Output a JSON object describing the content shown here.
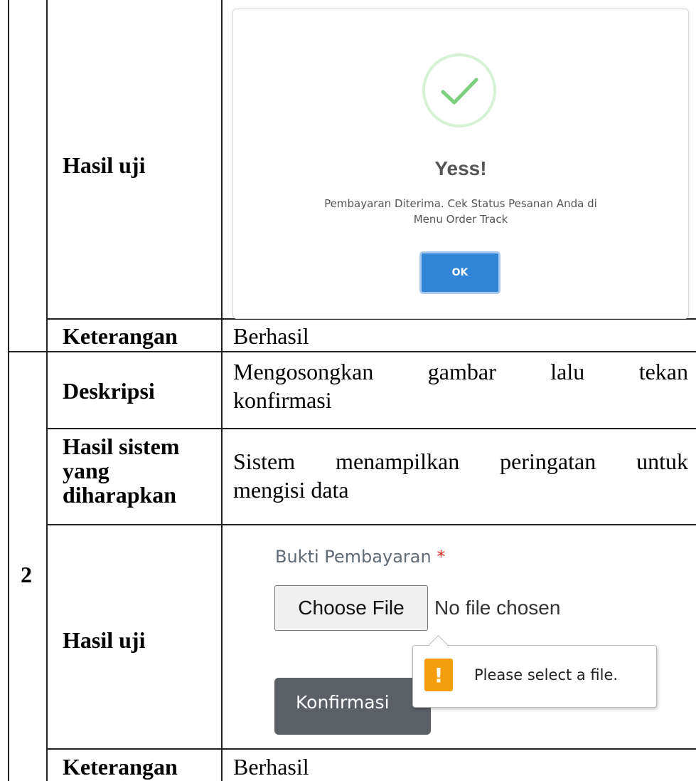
{
  "table": {
    "rows": {
      "hasil_uji_1": "Hasil uji",
      "keterangan_1_label": "Keterangan",
      "keterangan_1_value": "Berhasil",
      "number_2": "2",
      "deskripsi_label": "Deskripsi",
      "deskripsi_line1": "Mengosongkan gambar lalu tekan",
      "deskripsi_line2": "konfirmasi",
      "hasil_sistem_label_line1": "Hasil sistem",
      "hasil_sistem_label_line2": "yang",
      "hasil_sistem_label_line3": "diharapkan",
      "hasil_sistem_line1": "Sistem menampilkan peringatan untuk",
      "hasil_sistem_line2": "mengisi data",
      "hasil_uji_2": "Hasil uji",
      "keterangan_2_label": "Keterangan",
      "keterangan_2_value": "Berhasil"
    }
  },
  "dialog": {
    "title": "Yess!",
    "message_line1": "Pembayaran Diterima. Cek Status Pesanan Anda di",
    "message_line2": "Menu Order Track",
    "ok_label": "OK",
    "success_icon": "check-icon",
    "accent_color": "#3085d6"
  },
  "form": {
    "field_label": "Bukti Pembayaran",
    "required_mark": "*",
    "choose_file_label": "Choose File",
    "no_file_text": "No file chosen",
    "submit_label": "Konfirmasi",
    "tooltip_text": "Please select a file.",
    "warning_icon": "exclamation-icon",
    "warning_glyph": "!"
  }
}
